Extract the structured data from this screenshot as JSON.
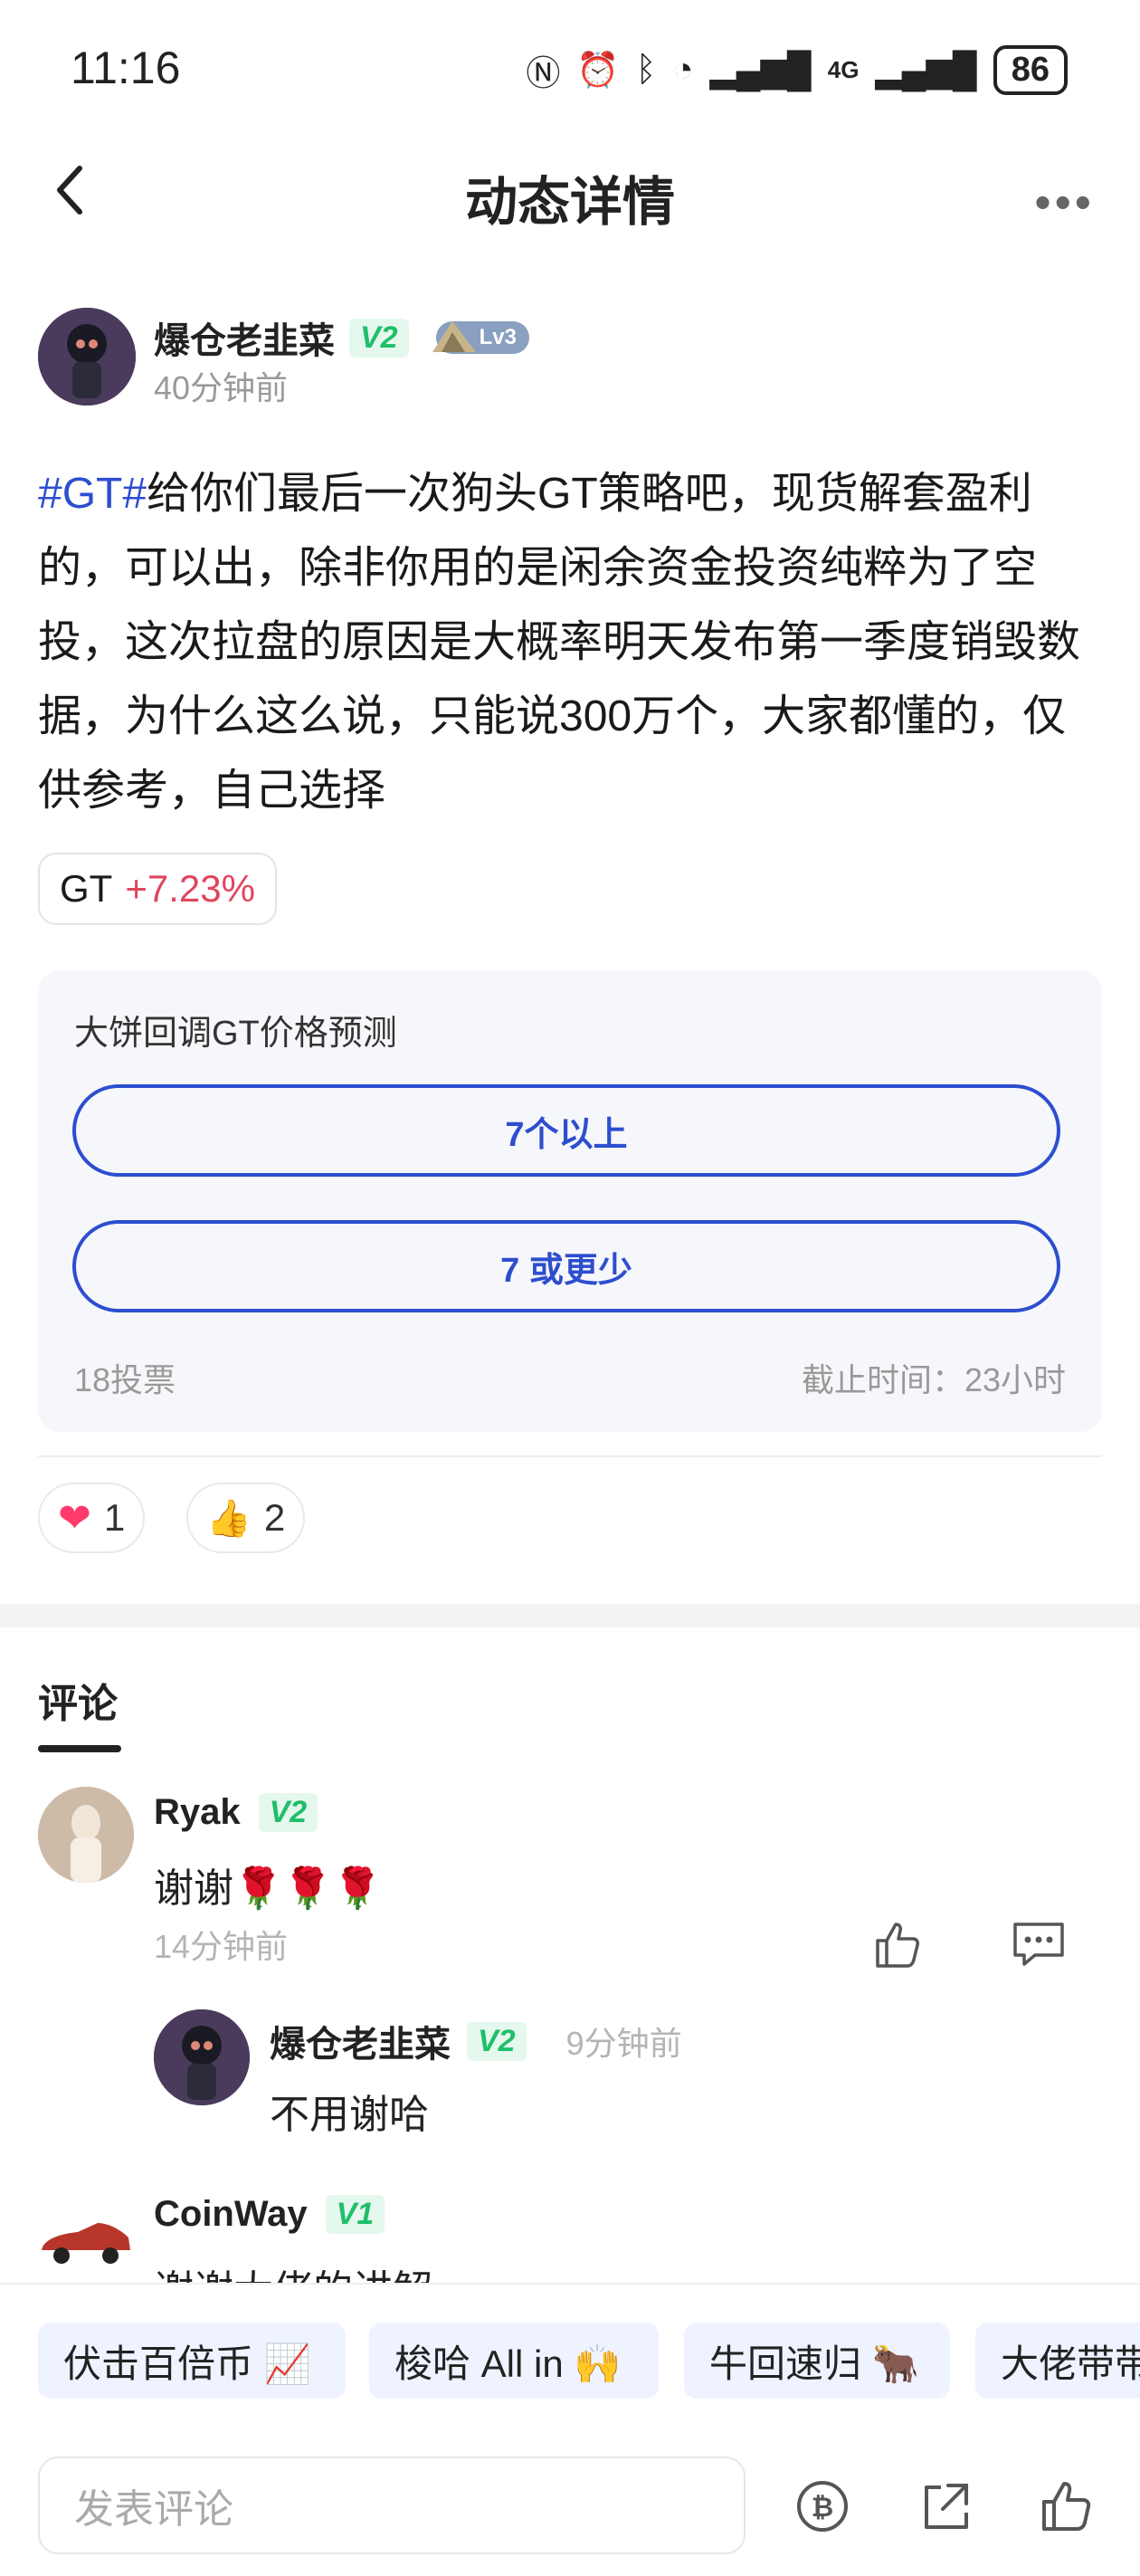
{
  "status_bar": {
    "time": "11:16",
    "network": "4G",
    "battery": "86"
  },
  "header": {
    "title": "动态详情"
  },
  "author": {
    "name": "爆仓老韭菜",
    "badge": "V2",
    "level": "Lv3",
    "time": "40分钟前"
  },
  "post": {
    "tag": "#GT#",
    "text": "给你们最后一次狗头GT策略吧，现货解套盈利的，可以出，除非你用的是闲余资金投资纯粹为了空投，这次拉盘的原因是大概率明天发布第一季度销毁数据，为什么这么说，只能说300万个，大家都懂的，仅供参考，自己选择"
  },
  "coin_chip": {
    "symbol": "GT",
    "change": "+7.23%",
    "change_color": "#e0455e"
  },
  "poll": {
    "title": "大饼回调GT价格预测",
    "options": [
      "7个以上",
      "7 或更少"
    ],
    "votes": "18投票",
    "deadline": "截止时间：23小时"
  },
  "reactions": [
    {
      "icon": "heart-icon",
      "count": "1"
    },
    {
      "icon": "thumbs-up-icon",
      "count": "2"
    }
  ],
  "comments_tab": "评论",
  "comments": [
    {
      "name": "Ryak",
      "badge": "V2",
      "text": "谢谢🌹🌹🌹",
      "time": "14分钟前",
      "reply": {
        "name": "爆仓老韭菜",
        "badge": "V2",
        "time": "9分钟前",
        "text": "不用谢哈"
      }
    },
    {
      "name": "CoinWay",
      "badge": "V1",
      "text": "谢谢大佬的讲解"
    }
  ],
  "quick_replies": [
    "伏击百倍币 📈",
    "梭哈 All in 🙌",
    "牛回速归 🐂",
    "大佬带带"
  ],
  "input": {
    "placeholder": "发表评论"
  },
  "colors": {
    "accent": "#2d4ecf",
    "verified": "#1fbf6a"
  }
}
